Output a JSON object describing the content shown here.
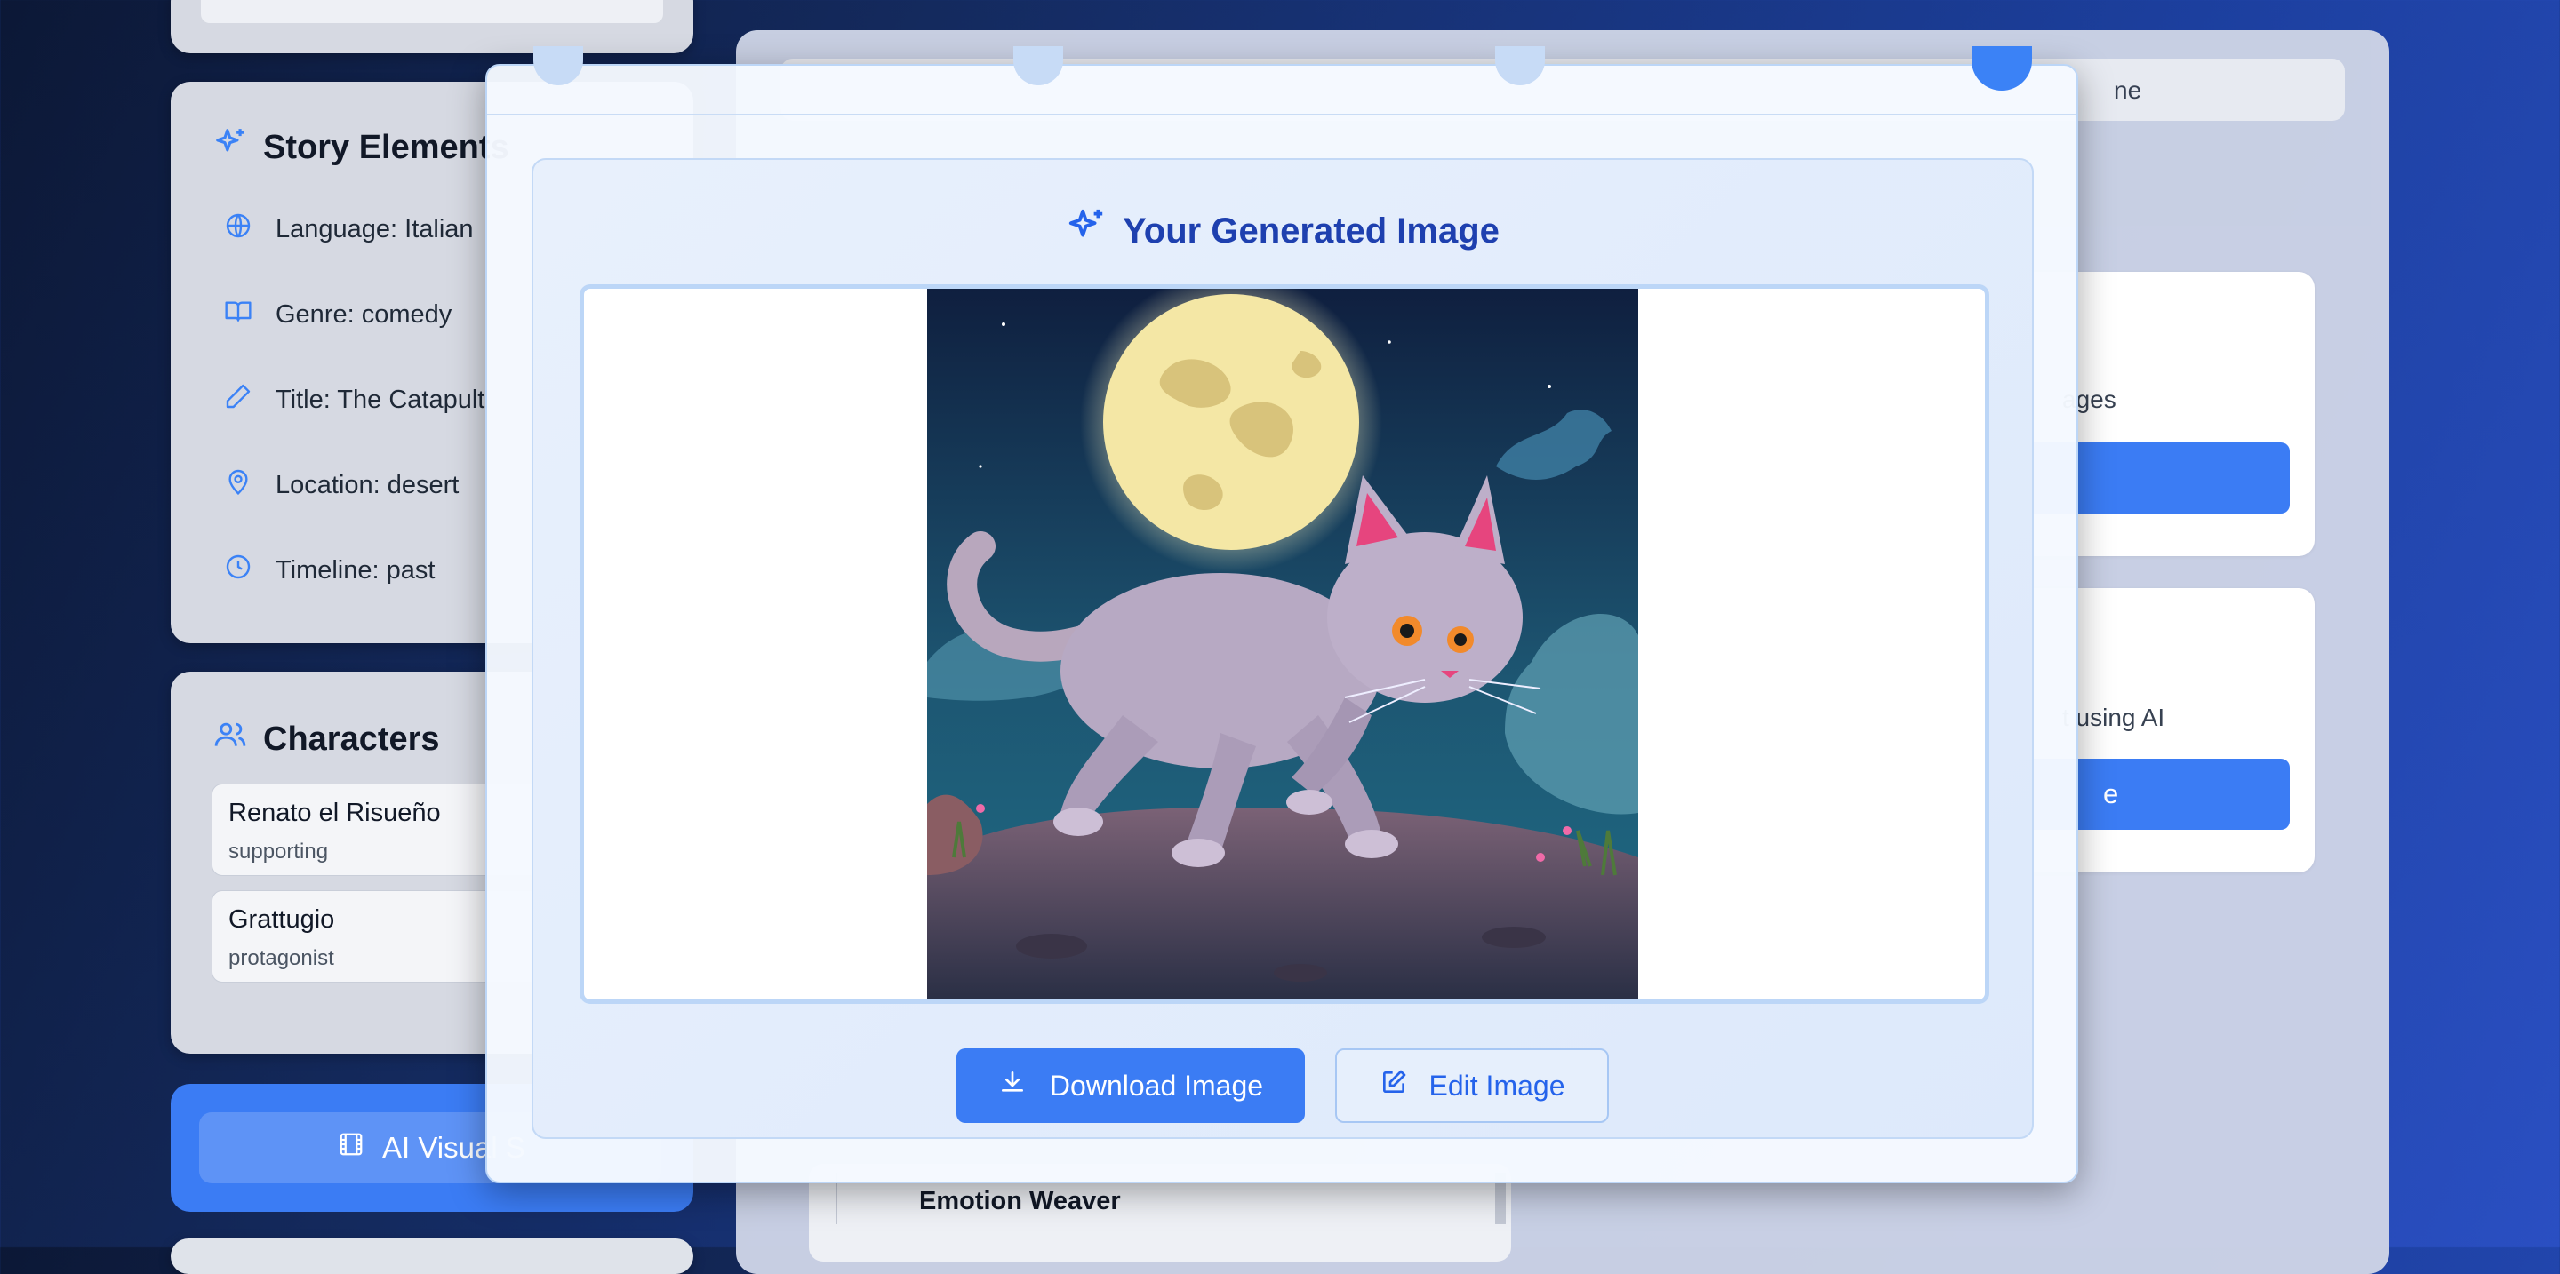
{
  "story_elements": {
    "title": "Story Elements",
    "items": [
      {
        "icon": "globe-icon",
        "text": "Language: Italian"
      },
      {
        "icon": "book-open-icon",
        "text": "Genre: comedy"
      },
      {
        "icon": "pen-icon",
        "text": "Title: The Catapult"
      },
      {
        "icon": "map-pin-icon",
        "text": "Location: desert"
      },
      {
        "icon": "clock-icon",
        "text": "Timeline: past"
      }
    ]
  },
  "characters": {
    "title": "Characters",
    "items": [
      {
        "name": "Renato el Risueño",
        "role": "supporting"
      },
      {
        "name": "Grattugio",
        "role": "protagonist"
      }
    ]
  },
  "ai_visual": {
    "label": "AI Visual S"
  },
  "right_panel": {
    "top_text": "ne",
    "card1": {
      "desc": "ages",
      "button": ""
    },
    "card2": {
      "desc": "t using AI",
      "button": "e"
    },
    "emotion": "Emotion Weaver"
  },
  "modal": {
    "title": "Your Generated Image",
    "download_label": "Download Image",
    "edit_label": "Edit Image"
  },
  "colors": {
    "accent": "#3b7cf4",
    "title_blue": "#1e40af"
  }
}
